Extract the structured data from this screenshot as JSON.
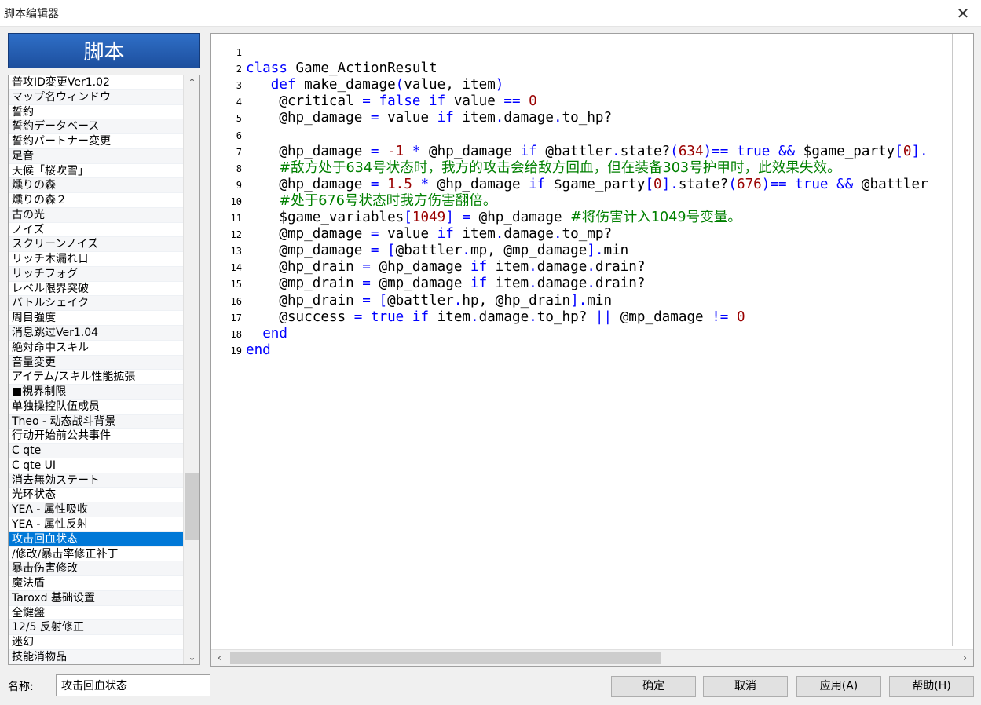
{
  "window": {
    "title": "脚本编辑器",
    "close_icon": "close-icon"
  },
  "sidebar": {
    "header": "脚本",
    "items": [
      "普攻ID変更Ver1.02",
      "マップ名ウィンドウ",
      "誓約",
      "誓約データベース",
      "誓約パートナー変更",
      "足音",
      "天候「桜吹雪」",
      "燻りの森",
      "燻りの森２",
      "古の光",
      "ノイズ",
      "スクリーンノイズ",
      "リッチ木漏れ日",
      "リッチフォグ",
      "レベル限界突破",
      "バトルシェイク",
      "周目強度",
      "消息跳过Ver1.04",
      "絶対命中スキル",
      "音量変更",
      "アイテム/スキル性能拡張",
      "■視界制限",
      "单独操控队伍成员",
      "Theo - 动态战斗背景",
      "行动开始前公共事件",
      "C qte",
      "C qte UI",
      "消去無効ステート",
      "光环状态",
      "YEA - 属性吸收",
      "YEA - 属性反射",
      "攻击回血状态",
      "/修改/暴击率修正补丁",
      "暴击伤害修改",
      "魔法盾",
      "Taroxd 基础设置",
      "全鍵盤",
      "12/5 反射修正",
      "迷幻",
      "技能消物品"
    ],
    "selected_index": 31
  },
  "editor": {
    "line_numbers": [
      "1",
      "2",
      "3",
      "4",
      "5",
      "6",
      "7",
      "8",
      "9",
      "10",
      "11",
      "12",
      "13",
      "14",
      "15",
      "16",
      "17",
      "18",
      "19"
    ],
    "lines": [
      [],
      [
        [
          "kw",
          "class"
        ],
        [
          "t",
          " Game_ActionResult"
        ]
      ],
      [
        [
          "t",
          "   "
        ],
        [
          "kw",
          "def"
        ],
        [
          "t",
          " make_damage"
        ],
        [
          "br",
          "("
        ],
        [
          "t",
          "value, item"
        ],
        [
          "br",
          ")"
        ]
      ],
      [
        [
          "t",
          "    @critical "
        ],
        [
          "op",
          "="
        ],
        [
          "t",
          " "
        ],
        [
          "kw",
          "false"
        ],
        [
          "t",
          " "
        ],
        [
          "kw",
          "if"
        ],
        [
          "t",
          " value "
        ],
        [
          "op",
          "=="
        ],
        [
          "t",
          " "
        ],
        [
          "num",
          "0"
        ]
      ],
      [
        [
          "t",
          "    @hp_damage "
        ],
        [
          "op",
          "="
        ],
        [
          "t",
          " value "
        ],
        [
          "kw",
          "if"
        ],
        [
          "t",
          " item"
        ],
        [
          "op",
          "."
        ],
        [
          "t",
          "damage"
        ],
        [
          "op",
          "."
        ],
        [
          "t",
          "to_hp?"
        ]
      ],
      [],
      [
        [
          "t",
          "    @hp_damage "
        ],
        [
          "op",
          "="
        ],
        [
          "t",
          " "
        ],
        [
          "num",
          "-1"
        ],
        [
          "t",
          " "
        ],
        [
          "op",
          "*"
        ],
        [
          "t",
          " @hp_damage "
        ],
        [
          "kw",
          "if"
        ],
        [
          "t",
          " @battler"
        ],
        [
          "op",
          "."
        ],
        [
          "t",
          "state?"
        ],
        [
          "br",
          "("
        ],
        [
          "num",
          "634"
        ],
        [
          "br",
          ")"
        ],
        [
          "op",
          "=="
        ],
        [
          "t",
          " "
        ],
        [
          "kw",
          "true"
        ],
        [
          "t",
          " "
        ],
        [
          "op",
          "&&"
        ],
        [
          "t",
          " $game_party"
        ],
        [
          "br",
          "["
        ],
        [
          "num",
          "0"
        ],
        [
          "br",
          "]"
        ],
        [
          "op",
          "."
        ]
      ],
      [
        [
          "t",
          "    "
        ],
        [
          "cm",
          "#敌方处于634号状态时，我方的攻击会给敌方回血，但在装备303号护甲时，此效果失效。"
        ]
      ],
      [
        [
          "t",
          "    @hp_damage "
        ],
        [
          "op",
          "="
        ],
        [
          "t",
          " "
        ],
        [
          "num",
          "1.5"
        ],
        [
          "t",
          " "
        ],
        [
          "op",
          "*"
        ],
        [
          "t",
          " @hp_damage "
        ],
        [
          "kw",
          "if"
        ],
        [
          "t",
          " $game_party"
        ],
        [
          "br",
          "["
        ],
        [
          "num",
          "0"
        ],
        [
          "br",
          "]"
        ],
        [
          "op",
          "."
        ],
        [
          "t",
          "state?"
        ],
        [
          "br",
          "("
        ],
        [
          "num",
          "676"
        ],
        [
          "br",
          ")"
        ],
        [
          "op",
          "=="
        ],
        [
          "t",
          " "
        ],
        [
          "kw",
          "true"
        ],
        [
          "t",
          " "
        ],
        [
          "op",
          "&&"
        ],
        [
          "t",
          " @battler"
        ]
      ],
      [
        [
          "t",
          "    "
        ],
        [
          "cm",
          "#处于676号状态时我方伤害翻倍。"
        ]
      ],
      [
        [
          "t",
          "    $game_variables"
        ],
        [
          "br",
          "["
        ],
        [
          "num",
          "1049"
        ],
        [
          "br",
          "]"
        ],
        [
          "t",
          " "
        ],
        [
          "op",
          "="
        ],
        [
          "t",
          " @hp_damage "
        ],
        [
          "cm",
          "#将伤害计入1049号变量。"
        ]
      ],
      [
        [
          "t",
          "    @mp_damage "
        ],
        [
          "op",
          "="
        ],
        [
          "t",
          " value "
        ],
        [
          "kw",
          "if"
        ],
        [
          "t",
          " item"
        ],
        [
          "op",
          "."
        ],
        [
          "t",
          "damage"
        ],
        [
          "op",
          "."
        ],
        [
          "t",
          "to_mp?"
        ]
      ],
      [
        [
          "t",
          "    @mp_damage "
        ],
        [
          "op",
          "="
        ],
        [
          "t",
          " "
        ],
        [
          "br",
          "["
        ],
        [
          "t",
          "@battler"
        ],
        [
          "op",
          "."
        ],
        [
          "t",
          "mp, @mp_damage"
        ],
        [
          "br",
          "]"
        ],
        [
          "op",
          "."
        ],
        [
          "t",
          "min"
        ]
      ],
      [
        [
          "t",
          "    @hp_drain "
        ],
        [
          "op",
          "="
        ],
        [
          "t",
          " @hp_damage "
        ],
        [
          "kw",
          "if"
        ],
        [
          "t",
          " item"
        ],
        [
          "op",
          "."
        ],
        [
          "t",
          "damage"
        ],
        [
          "op",
          "."
        ],
        [
          "t",
          "drain?"
        ]
      ],
      [
        [
          "t",
          "    @mp_drain "
        ],
        [
          "op",
          "="
        ],
        [
          "t",
          " @mp_damage "
        ],
        [
          "kw",
          "if"
        ],
        [
          "t",
          " item"
        ],
        [
          "op",
          "."
        ],
        [
          "t",
          "damage"
        ],
        [
          "op",
          "."
        ],
        [
          "t",
          "drain?"
        ]
      ],
      [
        [
          "t",
          "    @hp_drain "
        ],
        [
          "op",
          "="
        ],
        [
          "t",
          " "
        ],
        [
          "br",
          "["
        ],
        [
          "t",
          "@battler"
        ],
        [
          "op",
          "."
        ],
        [
          "t",
          "hp, @hp_drain"
        ],
        [
          "br",
          "]"
        ],
        [
          "op",
          "."
        ],
        [
          "t",
          "min"
        ]
      ],
      [
        [
          "t",
          "    @success "
        ],
        [
          "op",
          "="
        ],
        [
          "t",
          " "
        ],
        [
          "kw",
          "true"
        ],
        [
          "t",
          " "
        ],
        [
          "kw",
          "if"
        ],
        [
          "t",
          " item"
        ],
        [
          "op",
          "."
        ],
        [
          "t",
          "damage"
        ],
        [
          "op",
          "."
        ],
        [
          "t",
          "to_hp? "
        ],
        [
          "op",
          "||"
        ],
        [
          "t",
          " @mp_damage "
        ],
        [
          "op",
          "!="
        ],
        [
          "t",
          " "
        ],
        [
          "num",
          "0"
        ]
      ],
      [
        [
          "t",
          "  "
        ],
        [
          "kw",
          "end"
        ]
      ],
      [
        [
          "kw",
          "end"
        ]
      ]
    ]
  },
  "footer": {
    "name_label": "名称:",
    "name_value": "攻击回血状态",
    "ok_label": "确定",
    "cancel_label": "取消",
    "apply_label": "应用(A)",
    "help_label": "帮助(H)"
  }
}
